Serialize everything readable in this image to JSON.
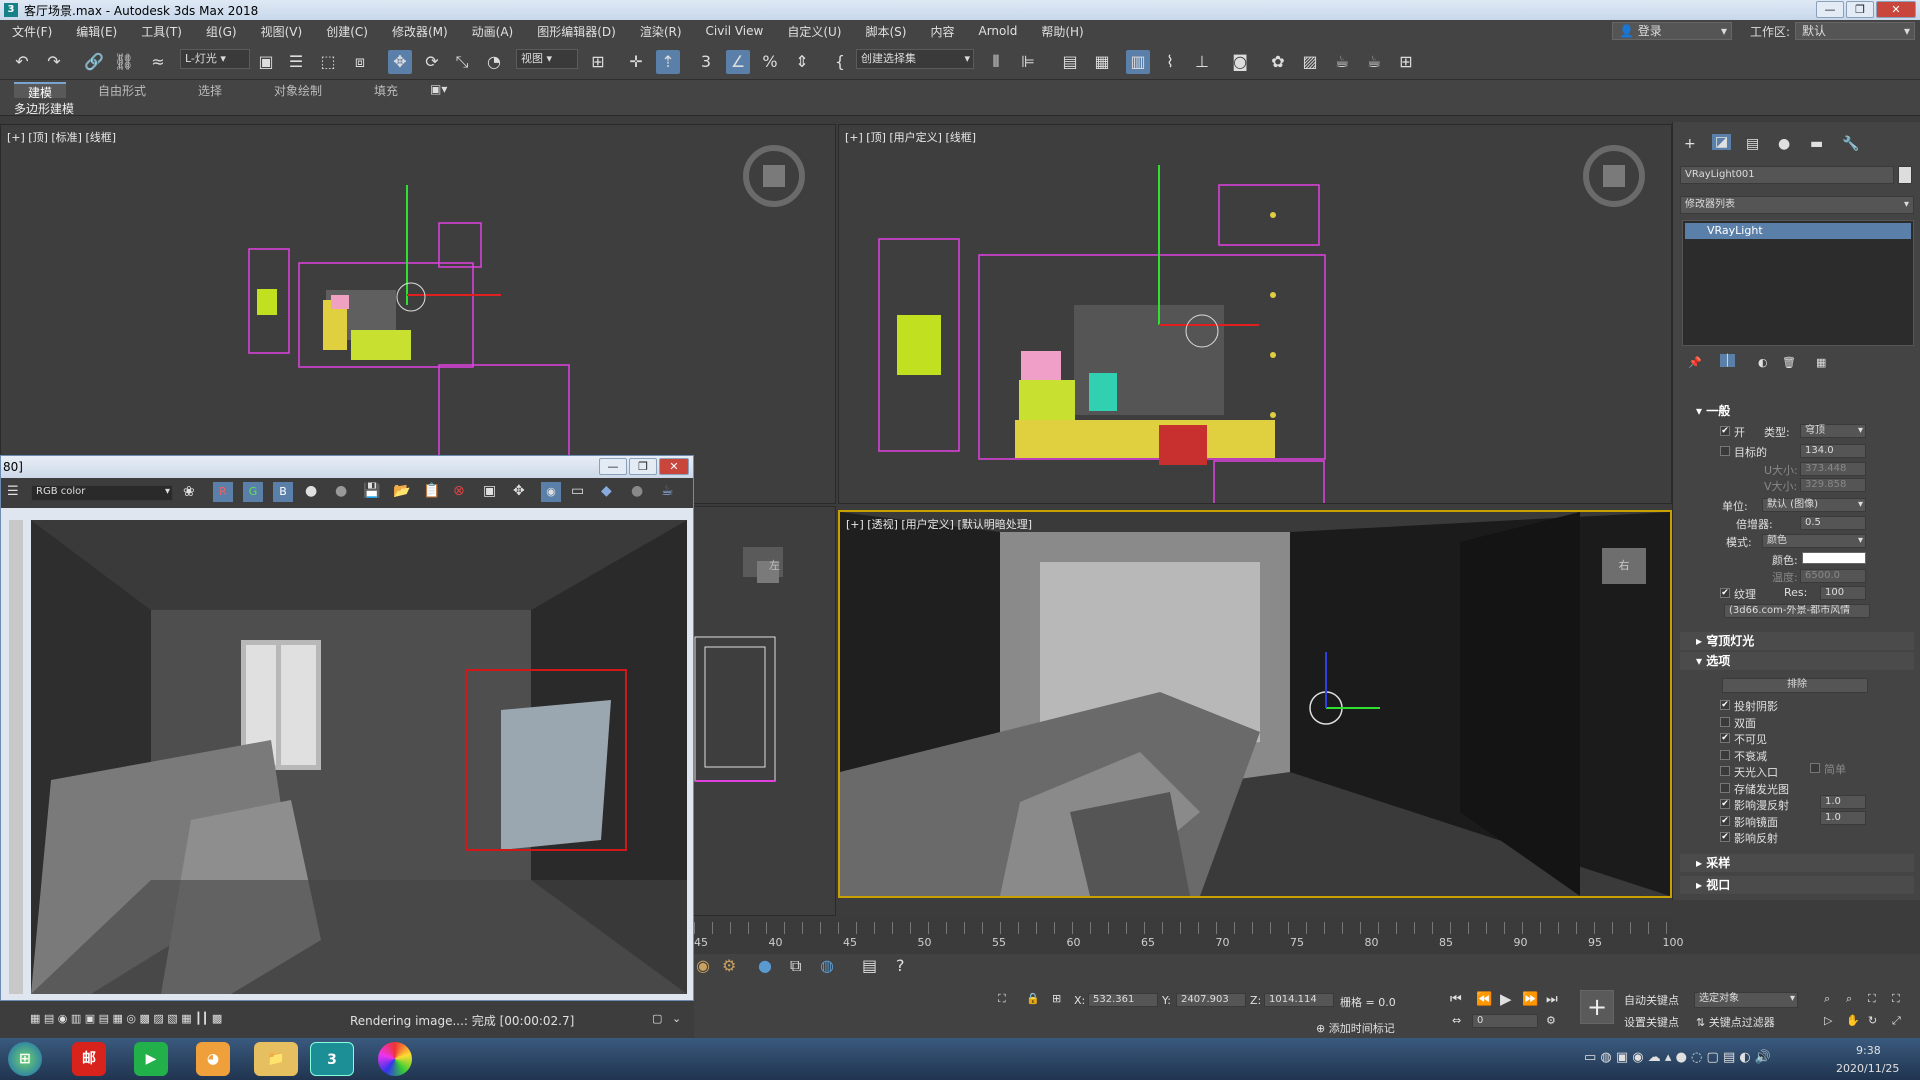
{
  "window": {
    "title": "客厅场景.max - Autodesk 3ds Max 2018",
    "app_icon": "3"
  },
  "menu": [
    "文件(F)",
    "编辑(E)",
    "工具(T)",
    "组(G)",
    "视图(V)",
    "创建(C)",
    "修改器(M)",
    "动画(A)",
    "图形编辑器(D)",
    "渲染(R)",
    "Civil View",
    "自定义(U)",
    "脚本(S)",
    "内容",
    "Arnold",
    "帮助(H)"
  ],
  "account": {
    "login": "登录",
    "workspace_label": "工作区:",
    "workspace_value": "默认"
  },
  "toolbar": {
    "layer_select": "L-灯光",
    "ref_coord": "视图",
    "selection_set": "创建选择集"
  },
  "ribbon": {
    "tabs": [
      "建模",
      "自由形式",
      "选择",
      "对象绘制",
      "填充"
    ],
    "subtitle": "多边形建模"
  },
  "viewports": {
    "top": "[+] [顶] [标准] [线框]",
    "top_right": "[+] [顶] [用户定义] [线框]",
    "persp": "[+] [透视] [用户定义] [默认明暗处理]",
    "left_cube": "左",
    "right_cube": "右"
  },
  "panel": {
    "object_name": "VRayLight001",
    "modifier_list": "修改器列表",
    "stack_item": "VRayLight",
    "general": "一般",
    "on_label": "开",
    "type_label": "类型:",
    "type_value": "穹顶",
    "targeted_label": "目标的",
    "targeted_value": "134.0",
    "usize_label": "U大小:",
    "usize_value": "373.448",
    "vsize_label": "V大小:",
    "vsize_value": "329.858",
    "units_label": "单位:",
    "units_value": "默认 (图像)",
    "multiplier_label": "倍增器:",
    "multiplier_value": "0.5",
    "mode_label": "模式:",
    "mode_value": "颜色",
    "color_label": "颜色:",
    "temp_label": "温度:",
    "temp_value": "6500.0",
    "texture_label": "纹理",
    "res_label": "Res:",
    "res_value": "100",
    "texture_map": "(3d66.com-外景-都市风情",
    "dome_section": "穹顶灯光",
    "options_section": "选项",
    "exclude_btn": "排除",
    "opts": [
      "投射阴影",
      "双面",
      "不可见",
      "不衰减",
      "天光入口",
      "存储发光图",
      "影响漫反射",
      "影响镜面",
      "影响反射"
    ],
    "opts_checked": [
      true,
      false,
      true,
      false,
      false,
      false,
      true,
      true,
      true
    ],
    "simple_label": "简单",
    "diffuse_value": "1.0",
    "specular_value": "1.0",
    "sampling_section": "采样",
    "viewport_section": "视口"
  },
  "render_window": {
    "title": "80]",
    "channel": "RGB color",
    "status": "Rendering image...: 完成 [00:00:02.7]"
  },
  "timeline": {
    "ticks": [
      "45",
      "40",
      "45",
      "50",
      "55",
      "60",
      "65",
      "70",
      "75",
      "80",
      "85",
      "90",
      "95",
      "100"
    ]
  },
  "status": {
    "x_label": "X:",
    "x_value": "532.361",
    "y_label": "Y:",
    "y_value": "2407.903",
    "z_label": "Z:",
    "z_value": "1014.114",
    "grid": "栅格 = 0.0",
    "add_time_tag": "添加时间标记",
    "auto_key": "自动关键点",
    "set_key": "设置关键点",
    "selected_obj": "选定对象",
    "key_filter": "关键点过滤器",
    "frame": "0"
  },
  "taskbar": {
    "time": "9:38",
    "date": "2020/11/25"
  },
  "colors": {
    "accent": "#5a7fa8",
    "magenta": "#e040e0",
    "selection_red": "#d01818"
  }
}
